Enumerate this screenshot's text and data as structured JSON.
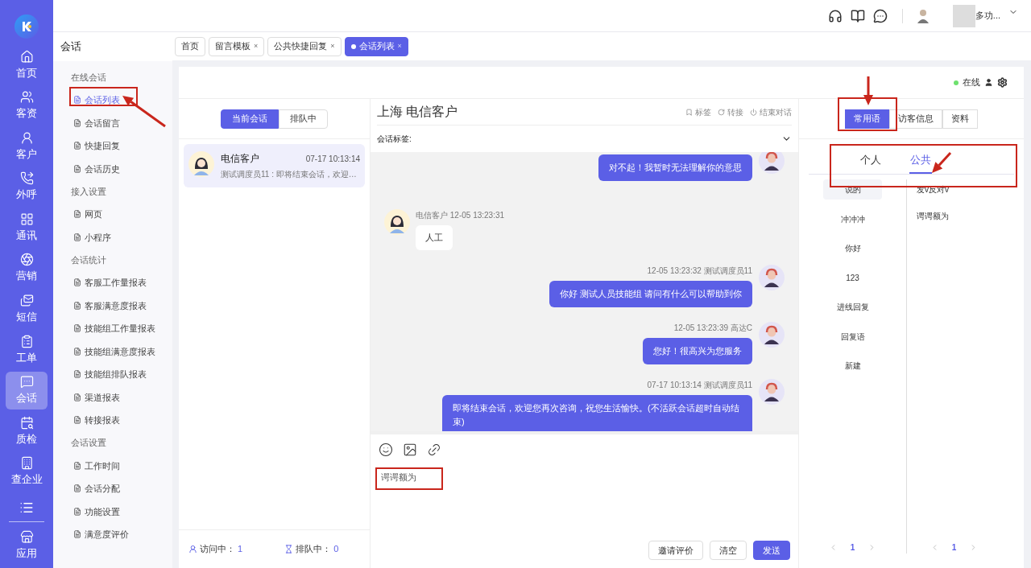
{
  "app_nav": [
    {
      "label": "首页",
      "selected": false
    },
    {
      "label": "客资",
      "selected": false
    },
    {
      "label": "客户",
      "selected": false
    },
    {
      "label": "外呼",
      "selected": false
    },
    {
      "label": "通讯",
      "selected": false
    },
    {
      "label": "营销",
      "selected": false
    },
    {
      "label": "短信",
      "selected": false
    },
    {
      "label": "工单",
      "selected": false
    },
    {
      "label": "会话",
      "selected": true
    },
    {
      "label": "质检",
      "selected": false
    },
    {
      "label": "查企业",
      "selected": false
    },
    {
      "label": "应用",
      "selected": false
    }
  ],
  "sub_sidebar": {
    "title": "会话",
    "groups": [
      {
        "heading": "在线会话",
        "items": [
          {
            "label": "会话列表",
            "selected": true
          },
          {
            "label": "会话留言",
            "selected": false
          },
          {
            "label": "快捷回复",
            "selected": false
          },
          {
            "label": "会话历史",
            "selected": false
          }
        ]
      },
      {
        "heading": "接入设置",
        "items": [
          {
            "label": "网页",
            "selected": false
          },
          {
            "label": "小程序",
            "selected": false
          }
        ]
      },
      {
        "heading": "会话统计",
        "items": [
          {
            "label": "客服工作量报表",
            "selected": false
          },
          {
            "label": "客服满意度报表",
            "selected": false
          },
          {
            "label": "技能组工作量报表",
            "selected": false
          },
          {
            "label": "技能组满意度报表",
            "selected": false
          },
          {
            "label": "技能组排队报表",
            "selected": false
          },
          {
            "label": "渠道报表",
            "selected": false
          },
          {
            "label": "转接报表",
            "selected": false
          }
        ]
      },
      {
        "heading": "会话设置",
        "items": [
          {
            "label": "工作时间",
            "selected": false
          },
          {
            "label": "会话分配",
            "selected": false
          },
          {
            "label": "功能设置",
            "selected": false
          },
          {
            "label": "满意度评价",
            "selected": false
          }
        ]
      }
    ]
  },
  "header": {
    "user_name": "多功..."
  },
  "tabs": [
    {
      "label": "首页",
      "selected": false
    },
    {
      "label": "留言模板",
      "close": "×",
      "selected": false
    },
    {
      "label": "公共快捷回复",
      "close": "×",
      "selected": false
    },
    {
      "label": "会话列表",
      "close": "×",
      "selected": true
    }
  ],
  "status": {
    "label": "在线",
    "online": true
  },
  "session_tabs": [
    {
      "label": "当前会话",
      "selected": true
    },
    {
      "label": "排队中",
      "selected": false
    }
  ],
  "sessions": [
    {
      "name": "电信客户",
      "time": "07-17 10:13:14",
      "preview": "测试调度员11 : 即将结束会话，欢迎…",
      "selected": true
    }
  ],
  "counts": [
    {
      "label": "访问中：",
      "value": "1"
    },
    {
      "label": "排队中：",
      "value": "0"
    }
  ],
  "chat": {
    "title": "上海 电信客户",
    "actions": [
      "标签",
      "转接",
      "结束对话"
    ],
    "tag_label": "会话标签:",
    "messages": [
      {
        "kind": "agent",
        "text": "对不起！我暂时无法理解你的意思"
      },
      {
        "kind": "customer",
        "meta": "电信客户 12-05 13:23:31",
        "text": "人工"
      },
      {
        "kind": "agent",
        "meta": "12-05 13:23:32 测试调度员11",
        "text": "你好 测试人员技能组 请问有什么可以帮助到你"
      },
      {
        "kind": "agent",
        "meta": "12-05 13:23:39 高达C",
        "text": "您好！很高兴为您服务"
      },
      {
        "kind": "agent",
        "meta": "07-17 10:13:14 测试调度员11",
        "text": "即将结束会话，欢迎您再次咨询，祝您生活愉快。(不活跃会话超时自动结束)"
      }
    ],
    "input": {
      "value": "谔谔额为"
    },
    "buttons": [
      {
        "label": "邀请评价",
        "primary": false
      },
      {
        "label": "清空",
        "primary": false
      },
      {
        "label": "发送",
        "primary": true
      }
    ]
  },
  "right_panel": {
    "tabs": [
      {
        "label": "常用语",
        "selected": true
      },
      {
        "label": "访客信息",
        "selected": false
      },
      {
        "label": "资料",
        "selected": false
      }
    ],
    "scope_tabs": [
      {
        "label": "个人",
        "selected": false
      },
      {
        "label": "公共",
        "selected": true
      }
    ],
    "categories": [
      {
        "label": "说的",
        "selected": true
      },
      {
        "label": "冲冲冲",
        "selected": false
      },
      {
        "label": "你好",
        "selected": false
      },
      {
        "label": "123",
        "selected": false
      },
      {
        "label": "进线回复",
        "selected": false
      },
      {
        "label": "回复语",
        "selected": false
      },
      {
        "label": "新建",
        "selected": false
      }
    ],
    "phrases": [
      "发v反对v",
      "谔谔额为"
    ],
    "pagers": [
      {
        "page": "1"
      },
      {
        "page": "1"
      }
    ]
  }
}
